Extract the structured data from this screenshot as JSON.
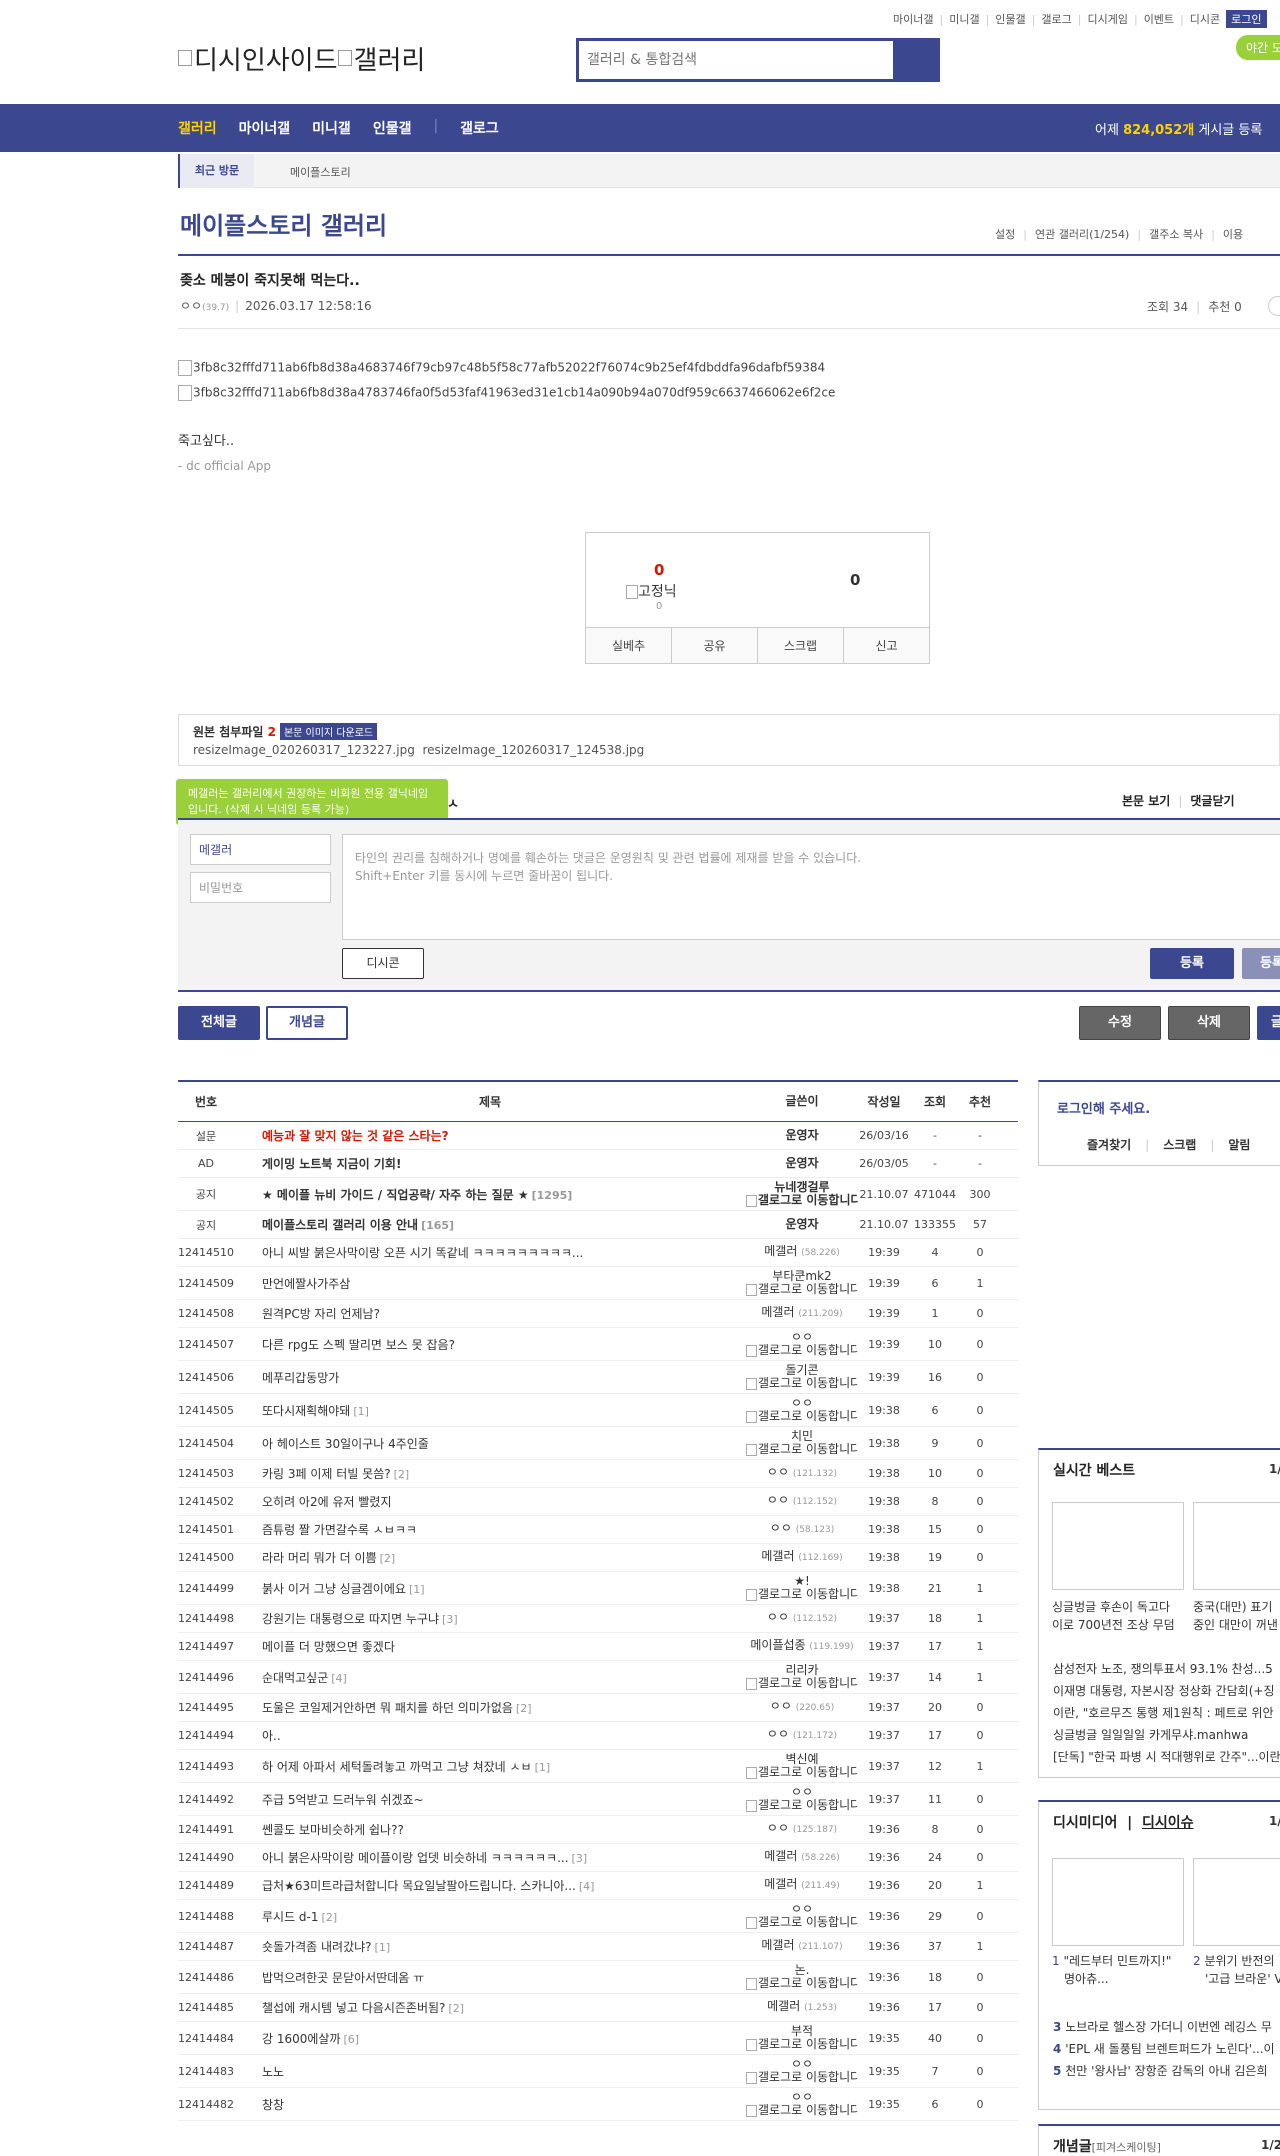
{
  "top_menu": [
    "마이너갤",
    "미니갤",
    "인물갤",
    "갤로그",
    "디시게임",
    "이벤트",
    "디시콘"
  ],
  "login_label": "로그인",
  "night_mode": "야간 모드",
  "logo_text_1": "디시인사이드",
  "logo_text_2": "갤러리",
  "search_placeholder": "갤러리 & 통합검색",
  "nav": {
    "items": [
      "갤러리",
      "마이너갤",
      "미니갤",
      "인물갤"
    ],
    "galog": "갤로그",
    "daily_prefix": "어제 ",
    "daily_count": "824,052개",
    "daily_suffix": " 게시글 등록"
  },
  "recent": {
    "tag": "최근 방문",
    "item": "메이플스토리"
  },
  "gallery_title": "메이플스토리 갤러리",
  "gallery_options": [
    "설정",
    "연관 갤러리(1/254)",
    "갤주소 복사",
    "이용"
  ],
  "post": {
    "title": "좆소 메붕이 죽지못해 먹는다..",
    "author": "ㅇㅇ",
    "author_ip": "(39.7)",
    "date": "2026.03.17 12:58:16",
    "views": "조회 34",
    "recommends": "추천 0",
    "images": [
      "3fb8c32fffd711ab6fb8d38a4683746f79cb97c48b5f58c77afb52022f76074c9b25ef4fdbddfa96dafbf59384",
      "3fb8c32fffd711ab6fb8d38a4783746fa0f5d53faf41963ed31e1cb14a090b94a070df959c6637466062e6f2ce"
    ],
    "body": "죽고싶다..",
    "signature": "- dc official App"
  },
  "recommend_box": {
    "up_count": "0",
    "fix_label": "고정닉",
    "fix_count": "0",
    "down_count": "0",
    "buttons": [
      "실베추",
      "공유",
      "스크랩",
      "신고"
    ]
  },
  "attach": {
    "label": "원본 첨부파일",
    "count": "2",
    "download": "본문 이미지 다운로드",
    "files": [
      "resizeImage_020260317_123227.jpg",
      "resizeImage_120260317_124538.jpg"
    ]
  },
  "comment": {
    "tooltip": "메갤러는 갤러리에서 권장하는 비회원 전용 갤닉네임입니다. (삭제 시 닉네임 등록 가능)",
    "tip_cut": "ㅅ",
    "view_body": "본문 보기",
    "close_comments": "댓글닫기",
    "nick_value": "메갤러",
    "password_placeholder": "비밀번호",
    "textarea_hint_1": "타인의 권리를 침해하거나 명예를 훼손하는 댓글은 운영원칙 및 관련 법률에 제재를 받을 수 있습니다.",
    "textarea_hint_2": "Shift+Enter 키를 동시에 누르면 줄바꿈이 됩니다.",
    "dccon": "디시콘",
    "submit": "등록",
    "submit2": "등록"
  },
  "list_buttons": {
    "all": "전체글",
    "concept": "개념글",
    "edit": "수정",
    "delete": "삭제",
    "write": "글"
  },
  "table": {
    "headers": [
      "번호",
      "제목",
      "글쓴이",
      "작성일",
      "조회",
      "추천"
    ],
    "notices": [
      {
        "num": "설문",
        "subject": "예능과 잘 맞지 않는 것 같은 스타는?",
        "red": true,
        "count": "",
        "writer": "운영자",
        "date": "26/03/16",
        "views": "-",
        "rec": "-"
      },
      {
        "num": "AD",
        "subject": "게이밍 노트북 지금이 기회!",
        "red": false,
        "count": "",
        "writer": "운영자",
        "date": "26/03/05",
        "views": "-",
        "rec": "-"
      },
      {
        "num": "공지",
        "subject": "★ 메이플 뉴비 가이드 / 직업공략/ 자주 하는 질문 ★",
        "red": false,
        "count": "[1295]",
        "writer": "뉴네갱걸루",
        "gicon": true,
        "date": "21.10.07",
        "views": "471044",
        "rec": "300"
      },
      {
        "num": "공지",
        "subject": "메이플스토리 갤러리 이용 안내",
        "red": false,
        "count": "[165]",
        "writer": "운영자",
        "date": "21.10.07",
        "views": "133355",
        "rec": "57"
      }
    ],
    "rows": [
      {
        "num": "12414510",
        "subject": "아니 씨발 붉은사막이랑 오픈 시기 똑같네 ㅋㅋㅋㅋㅋㅋㅋㅋㅋ...",
        "count": "",
        "writer": "메갤러",
        "ip": "(58.226)",
        "date": "19:39",
        "views": "4",
        "rec": "0"
      },
      {
        "num": "12414509",
        "subject": "만언에짤사가주삼",
        "count": "",
        "writer": "부타쿤mk2",
        "gicon": true,
        "date": "19:39",
        "views": "6",
        "rec": "1"
      },
      {
        "num": "12414508",
        "subject": "원격PC방 자리 언제남?",
        "count": "",
        "writer": "메갤러",
        "ip": "(211.209)",
        "date": "19:39",
        "views": "1",
        "rec": "0"
      },
      {
        "num": "12414507",
        "subject": "다른 rpg도 스펙 딸리면 보스 못 잡음?",
        "count": "",
        "writer": "ㅇㅇ",
        "gicon": true,
        "date": "19:39",
        "views": "10",
        "rec": "0"
      },
      {
        "num": "12414506",
        "subject": "메푸리갑동망가",
        "count": "",
        "writer": "돌기콘",
        "gicon": true,
        "date": "19:39",
        "views": "16",
        "rec": "0"
      },
      {
        "num": "12414505",
        "subject": "또다시재획해야돼",
        "count": "[1]",
        "writer": "ㅇㅇ",
        "gicon": true,
        "date": "19:38",
        "views": "6",
        "rec": "0"
      },
      {
        "num": "12414504",
        "subject": "아 헤이스트 30일이구나 4주인줄",
        "count": "",
        "writer": "치민",
        "gicon": true,
        "date": "19:38",
        "views": "9",
        "rec": "0"
      },
      {
        "num": "12414503",
        "subject": "카링 3페 이제 터빌 못씀?",
        "count": "[2]",
        "writer": "ㅇㅇ",
        "ip": "(121.132)",
        "date": "19:38",
        "views": "10",
        "rec": "0"
      },
      {
        "num": "12414502",
        "subject": "오히려 아2에 유저 빨렸지",
        "count": "",
        "writer": "ㅇㅇ",
        "ip": "(112.152)",
        "date": "19:38",
        "views": "8",
        "rec": "0"
      },
      {
        "num": "12414501",
        "subject": "즘튜렁 짤 가면갈수록 ㅅㅂㅋㅋ",
        "count": "",
        "writer": "ㅇㅇ",
        "ip": "(58.123)",
        "date": "19:38",
        "views": "15",
        "rec": "0"
      },
      {
        "num": "12414500",
        "subject": "라라 머리 뭐가 더 이쁨",
        "count": "[2]",
        "writer": "메갤러",
        "ip": "(112.169)",
        "date": "19:38",
        "views": "19",
        "rec": "0"
      },
      {
        "num": "12414499",
        "subject": "붉사 이거 그냥 싱글겜이에요",
        "count": "[1]",
        "writer": "★!",
        "gicon": true,
        "date": "19:38",
        "views": "21",
        "rec": "1"
      },
      {
        "num": "12414498",
        "subject": "강원기는 대통령으로 따지면 누구냐",
        "count": "[3]",
        "writer": "ㅇㅇ",
        "ip": "(112.152)",
        "date": "19:37",
        "views": "18",
        "rec": "1"
      },
      {
        "num": "12414497",
        "subject": "메이플 더 망했으면 좋겠다",
        "count": "",
        "writer": "메이플섭종",
        "ip": "(119.199)",
        "date": "19:37",
        "views": "17",
        "rec": "1"
      },
      {
        "num": "12414496",
        "subject": "순대먹고싶군",
        "count": "[4]",
        "writer": "리리카",
        "gicon": true,
        "date": "19:37",
        "views": "14",
        "rec": "1"
      },
      {
        "num": "12414495",
        "subject": "도울은 코일제거안하면 뭐 패치를 하던 의미가없음",
        "count": "[2]",
        "writer": "ㅇㅇ",
        "ip": "(220.65)",
        "date": "19:37",
        "views": "20",
        "rec": "0"
      },
      {
        "num": "12414494",
        "subject": "아..",
        "count": "",
        "writer": "ㅇㅇ",
        "ip": "(121.172)",
        "date": "19:37",
        "views": "17",
        "rec": "0"
      },
      {
        "num": "12414493",
        "subject": "하 어제 아파서 세턱돌려놓고 까먹고 그냥 쳐잤네 ㅅㅂ",
        "count": "[1]",
        "writer": "벽신예",
        "gicon": true,
        "date": "19:37",
        "views": "12",
        "rec": "1"
      },
      {
        "num": "12414492",
        "subject": "주급 5억받고 드러누워 쉬겠죠~",
        "count": "",
        "writer": "ㅇㅇ",
        "gicon": true,
        "date": "19:37",
        "views": "11",
        "rec": "0"
      },
      {
        "num": "12414491",
        "subject": "쎈콜도 보마비슷하게 쉽나??",
        "count": "",
        "writer": "ㅇㅇ",
        "ip": "(125.187)",
        "date": "19:36",
        "views": "8",
        "rec": "0"
      },
      {
        "num": "12414490",
        "subject": "아니 붉은사막이랑 메이플이랑 업뎃 비슷하네 ㅋㅋㅋㅋㅋㅋ...",
        "count": "[3]",
        "writer": "메갤러",
        "ip": "(58.226)",
        "date": "19:36",
        "views": "24",
        "rec": "0"
      },
      {
        "num": "12414489",
        "subject": "급처★63미트라급처합니다 목요일날팔아드립니다. 스카니아...",
        "count": "[4]",
        "writer": "메갤러",
        "ip": "(211.49)",
        "date": "19:36",
        "views": "20",
        "rec": "1"
      },
      {
        "num": "12414488",
        "subject": "루시드 d-1",
        "count": "[2]",
        "writer": "ㅇㅇ",
        "gicon": true,
        "date": "19:36",
        "views": "29",
        "rec": "0"
      },
      {
        "num": "12414487",
        "subject": "숏돌가격좀 내려갔냐?",
        "count": "[1]",
        "writer": "메갤러",
        "ip": "(211.107)",
        "date": "19:36",
        "views": "37",
        "rec": "1"
      },
      {
        "num": "12414486",
        "subject": "밥먹으려한곳 문닫아서딴데옴 ㅠ",
        "count": "",
        "writer": "논.",
        "gicon": true,
        "date": "19:36",
        "views": "18",
        "rec": "0"
      },
      {
        "num": "12414485",
        "subject": "챌섭에 캐시템 넣고 다음시즌존버됨?",
        "count": "[2]",
        "writer": "메갤러",
        "ip": "(1.253)",
        "date": "19:36",
        "views": "17",
        "rec": "0"
      },
      {
        "num": "12414484",
        "subject": "강 1600에살까",
        "count": "[6]",
        "writer": "부적",
        "gicon": true,
        "date": "19:35",
        "views": "40",
        "rec": "0"
      },
      {
        "num": "12414483",
        "subject": "노노",
        "count": "",
        "writer": "ㅇㅇ",
        "gicon": true,
        "date": "19:35",
        "views": "7",
        "rec": "0"
      },
      {
        "num": "12414482",
        "subject": "창창",
        "count": "",
        "writer": "ㅇㅇ",
        "gicon": true,
        "date": "19:35",
        "views": "6",
        "rec": "0"
      }
    ],
    "gallog_text": "갤로그로 이동합니다."
  },
  "sidebar": {
    "login_prompt": "로그인해 주세요.",
    "login_links": [
      "즐겨찾기",
      "스크랩",
      "알림"
    ],
    "best": {
      "title": "실시간 베스트",
      "page": "1/",
      "cap1": [
        "싱글벙글 후손이 독고다",
        "이로 700년전 조상 무덤"
      ],
      "cap2": [
        "중국(대만) 표기",
        "중인 대만이 꺼낸"
      ],
      "list": [
        "삼성전자 노조, 쟁의투표서 93.1% 찬성...5",
        "이재명 대통령, 자본시장 정상화 간담회(+징",
        "이란, \"호르무즈 통행 제1원칙 : 페트로 위안",
        "싱글벙글 일일일일 카게무샤.manhwa",
        "[단독] \"한국 파병 시 적대행위로 간주\"...이란"
      ]
    },
    "media": {
      "title1": "디시미디어",
      "title2": "디시이슈",
      "page": "1/",
      "cap1": [
        "1",
        "\"레드부터 민트까지!\"",
        "명아츄..."
      ],
      "cap2": [
        "2",
        "분위기 반전의",
        "'고급 브라운' V"
      ],
      "list": [
        [
          "3",
          "노브라로 헬스장 가더니 이번엔 레깅스 무"
        ],
        [
          "4",
          "'EPL 새 돌풍팀 브렌트퍼드가 노린다'...이"
        ],
        [
          "5",
          "천만 '왕사남' 장항준 감독의 아내 김은희"
        ]
      ]
    },
    "concept": {
      "title": "개념글",
      "sub": "[피겨스케이팅]",
      "page": "1/2"
    }
  }
}
